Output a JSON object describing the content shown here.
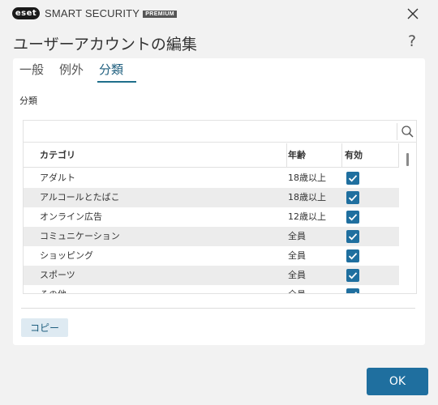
{
  "titlebar": {
    "logo_text": "eset",
    "product_name": "SMART SECURITY",
    "edition_badge": "PREMIUM",
    "close_icon": "close-icon"
  },
  "dialog": {
    "title": "ユーザーアカウントの編集",
    "help_label": "?"
  },
  "tabs": [
    {
      "label": "一般",
      "active": false
    },
    {
      "label": "例外",
      "active": false
    },
    {
      "label": "分類",
      "active": true
    }
  ],
  "section_label": "分類",
  "search": {
    "placeholder": "",
    "value": "",
    "icon": "search-icon"
  },
  "table": {
    "columns": [
      "カテゴリ",
      "年齢",
      "有効"
    ],
    "rows": [
      {
        "category": "アダルト",
        "age": "18歳以上",
        "enabled": true
      },
      {
        "category": "アルコールとたばこ",
        "age": "18歳以上",
        "enabled": true
      },
      {
        "category": "オンライン広告",
        "age": "12歳以上",
        "enabled": true
      },
      {
        "category": "コミュニケーション",
        "age": "全員",
        "enabled": true
      },
      {
        "category": "ショッピング",
        "age": "全員",
        "enabled": true
      },
      {
        "category": "スポーツ",
        "age": "全員",
        "enabled": true
      },
      {
        "category": "その他",
        "age": "全員",
        "enabled": true
      }
    ]
  },
  "buttons": {
    "copy": "コピー",
    "ok": "OK"
  },
  "colors": {
    "accent": "#1f6f9f",
    "copy_bg": "#deeaf2",
    "row_shade": "#ececec",
    "background": "#f2f2f2"
  }
}
